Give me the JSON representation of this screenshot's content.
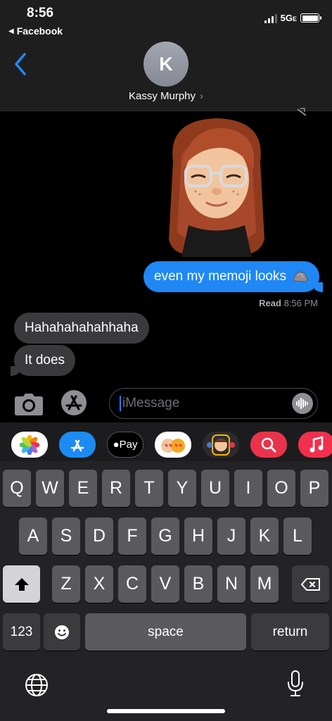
{
  "status_bar": {
    "time": "8:56",
    "back_app": "Facebook",
    "network": "5G",
    "network_suffix": "E"
  },
  "header": {
    "avatar_initial": "K",
    "contact_name": "Kassy Murphy",
    "back_icon": "chevron-left-icon"
  },
  "messages": [
    {
      "direction": "outgoing",
      "type": "memoji-sticker",
      "icon": "memoji-sticker"
    },
    {
      "direction": "outgoing",
      "text": "even my memoji looks",
      "emoji": "rock-icon"
    },
    {
      "direction": "incoming",
      "text": "Hahahahahahhaha"
    },
    {
      "direction": "incoming",
      "text": "It does"
    }
  ],
  "read_receipt": {
    "label": "Read",
    "time": "8:56 PM"
  },
  "input": {
    "placeholder": "iMessage"
  },
  "app_drawer": [
    "photos-app-icon",
    "app-store-icon",
    "apple-pay-icon",
    "memoji-stickers-icon",
    "animoji-icon",
    "images-search-icon",
    "music-app-icon"
  ],
  "apple_pay_label": "Pay",
  "keyboard": {
    "row1": [
      "Q",
      "W",
      "E",
      "R",
      "T",
      "Y",
      "U",
      "I",
      "O",
      "P"
    ],
    "row2": [
      "A",
      "S",
      "D",
      "F",
      "G",
      "H",
      "J",
      "K",
      "L"
    ],
    "row3": [
      "Z",
      "X",
      "C",
      "V",
      "B",
      "N",
      "M"
    ],
    "numbers_label": "123",
    "space_label": "space",
    "return_label": "return"
  },
  "colors": {
    "accent_blue": "#1f88f5",
    "incoming_bubble": "#3a3a3c",
    "key": "#5a5a5e",
    "fn_key": "#3b3b3e"
  }
}
